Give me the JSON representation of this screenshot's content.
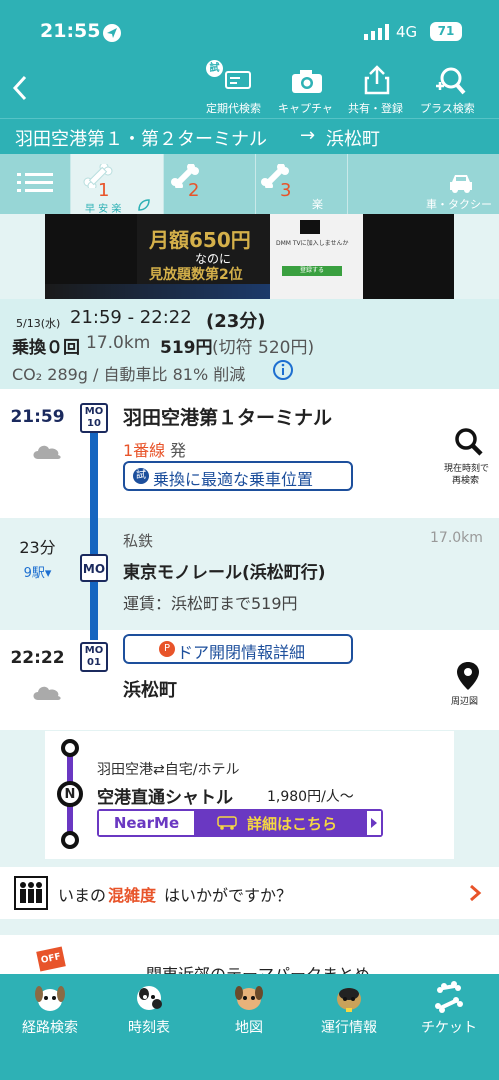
{
  "status_bar": {
    "time": "21:55",
    "network": "4G",
    "battery": "71"
  },
  "toolbar": {
    "back_label": "<",
    "trial_badge": "試",
    "items": [
      {
        "icon": "commuter-pass-icon",
        "label": "定期代検索"
      },
      {
        "icon": "camera-icon",
        "label": "キャプチャ"
      },
      {
        "icon": "share-icon",
        "label": "共有・登録"
      },
      {
        "icon": "plus-search-icon",
        "label": "プラス検索"
      }
    ]
  },
  "route": {
    "from": "羽田空港第１・第２ターミナル",
    "arrow": "→",
    "to": "浜松町"
  },
  "tabs": [
    {
      "number": "1",
      "sub": "早 安 楽",
      "selected": true
    },
    {
      "number": "2",
      "sub": "",
      "selected": false
    },
    {
      "number": "3",
      "sub": "楽",
      "selected": false
    },
    {
      "number": "",
      "sub": "車・タクシー",
      "selected": false
    }
  ],
  "ad": {
    "title": "月額650円",
    "line2": "なのに",
    "line3": "見放題数第2位",
    "right_text": "DMM TVに加入しませんか",
    "button": "登録する"
  },
  "summary": {
    "date": "5/13(水)",
    "time_range": "21:59 - 22:22",
    "duration": "(23分)",
    "transfers": "乗換０回",
    "distance": "17.0km",
    "fare": "519円",
    "ticket_fare": "(切符 520円)",
    "co2": "CO₂ 289g / 自動車比 81% 削減",
    "info_icon": "info-icon"
  },
  "departure": {
    "time": "21:59",
    "weather": "cloud-icon",
    "badge_line": "MO",
    "badge_num": "10",
    "station": "羽田空港第１ターミナル",
    "platform": "1番線",
    "platform_suffix": "発",
    "trial": "試",
    "position_button": "乗換に最適な乗車位置",
    "search_label1": "現在時刻で",
    "search_label2": "再検索"
  },
  "segment": {
    "duration": "23分",
    "stops": "9駅▾",
    "badge": "MO",
    "company": "私鉄",
    "distance": "17.0km",
    "line_name": "東京モノレール(浜松町行)",
    "fare_text": "運賃：浜松町まで519円"
  },
  "arrival": {
    "time": "22:22",
    "weather": "cloud-icon",
    "badge_line": "MO",
    "badge_num": "01",
    "door_button": "ドア開閉情報詳細",
    "door_icon": "P",
    "station": "浜松町",
    "map_label": "周辺図"
  },
  "shuttle": {
    "route": "羽田空港⇄自宅/ホテル",
    "title": "空港直通シャトル",
    "price": "1,980円/人〜",
    "brand": "NearMe",
    "cta": "詳細はこちら",
    "stop_icon": "N"
  },
  "congestion": {
    "prefix": "いまの",
    "highlight": "混雑度",
    "suffix": "はいかがですか？"
  },
  "teaser": {
    "badge": "OFF",
    "text": "関東近郊のテーマパークまとめ"
  },
  "bottom_nav": [
    {
      "label": "経路検索",
      "icon": "dog-route-icon"
    },
    {
      "label": "時刻表",
      "icon": "dog-timetable-icon"
    },
    {
      "label": "地図",
      "icon": "dog-map-icon"
    },
    {
      "label": "運行情報",
      "icon": "dog-info-icon"
    },
    {
      "label": "チケット",
      "icon": "ticket-icon"
    }
  ],
  "colors": {
    "teal": "#2eb1b5",
    "navy": "#1b2a5e",
    "line_blue": "#1565c0",
    "accent_red": "#e8542a",
    "purple": "#6a38c2"
  }
}
